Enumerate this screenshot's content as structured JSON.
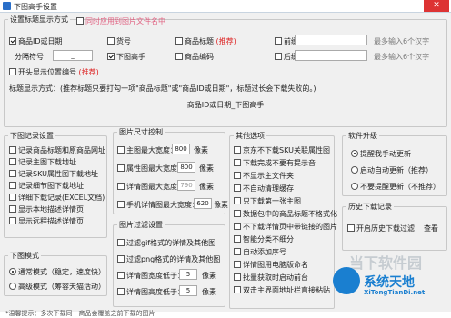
{
  "window": {
    "title": "下图高手设置",
    "close": "✕"
  },
  "title_fmt": {
    "legend": "设置标题显示方式",
    "sync_label": "同时应用到图片文件名中",
    "options": [
      {
        "label": "商品ID或日期",
        "checked": true
      },
      {
        "label": "货号",
        "checked": false
      },
      {
        "label": "商品标题",
        "checked": false,
        "note": "(推荐)"
      },
      {
        "label": "前缀",
        "checked": false
      },
      {
        "label": "下图高手",
        "checked": true
      },
      {
        "label": "商品编码",
        "checked": false
      },
      {
        "label": "后缀",
        "checked": false
      }
    ],
    "max_hint_1": "最多输入6个汉字",
    "max_hint_2": "最多输入6个汉字",
    "separator_label": "分隔符号",
    "separator_value": "_",
    "keep_sort": "开头显示位置编号",
    "keep_sort_note": "(推荐)",
    "format_desc": "标题显示方式：(推荐标题只要打勾一项\"商品标题\"或\"商品ID或日期\"，标题过长会下载失败的。)",
    "preview": "商品ID或日期_下图高手"
  },
  "record": {
    "legend": "下图记录设置",
    "items": [
      {
        "label": "记录商品标题和原商品网址",
        "checked": false
      },
      {
        "label": "记录主图下载地址",
        "checked": false
      },
      {
        "label": "记录SKU属性图下载地址",
        "checked": false
      },
      {
        "label": "记录细节图下载地址",
        "checked": false
      },
      {
        "label": "详细下载记录(EXCEL文档)",
        "checked": false
      },
      {
        "label": "显示本地描述详情页",
        "checked": false
      },
      {
        "label": "显示远程描述详情页",
        "checked": false
      }
    ]
  },
  "mode": {
    "legend": "下图模式",
    "items": [
      {
        "label": "通常模式（稳定，速度快）",
        "checked": true
      },
      {
        "label": "高级模式（筹容天猫活动）",
        "checked": false
      }
    ]
  },
  "size": {
    "legend": "图片尺寸控制",
    "rows": [
      {
        "label": "主图最大宽度：",
        "value": "800",
        "unit": "像素",
        "checked": false
      },
      {
        "label": "属性图最大宽度：",
        "value": "800",
        "unit": "像素",
        "checked": false
      },
      {
        "label": "详情图最大宽度：",
        "value": "790",
        "unit": "像素",
        "checked": false
      },
      {
        "label": "手机详情图最大宽度：",
        "value": "620",
        "unit": "像素",
        "checked": false
      }
    ]
  },
  "filter": {
    "legend": "图片过滤设置",
    "rows": [
      {
        "label": "过滤gif格式的详情及其他图",
        "checked": false
      },
      {
        "label": "过滤png格式的详情及其他图",
        "checked": false
      },
      {
        "label": "详情图宽度低于：",
        "value": "5",
        "unit": "像素",
        "checked": false
      },
      {
        "label": "详情图高度低于：",
        "value": "5",
        "unit": "像素",
        "checked": false
      }
    ]
  },
  "other": {
    "legend": "其他选项",
    "items": [
      {
        "label": "京东不下载SKU关联属性图",
        "checked": false
      },
      {
        "label": "下载完成不要有提示音",
        "checked": false
      },
      {
        "label": "不显示主文件夹",
        "checked": false
      },
      {
        "label": "不自动清理缓存",
        "checked": false
      },
      {
        "label": "只下载第一张主图",
        "checked": false
      },
      {
        "label": "数据包中的商品标题不格式化",
        "checked": false
      },
      {
        "label": "不下载详情页中带链接的图片",
        "checked": false
      },
      {
        "label": "智能分类不细分",
        "checked": false
      },
      {
        "label": "自动添加序号",
        "checked": false
      },
      {
        "label": "详情图用电脑版命名",
        "checked": false
      },
      {
        "label": "批量获取时启动前台",
        "checked": false
      },
      {
        "label": "双击主界面地址栏直接粘贴",
        "checked": false
      }
    ]
  },
  "update": {
    "legend": "软件升级",
    "items": [
      {
        "label": "提醒我手动更新",
        "checked": true
      },
      {
        "label": "启动自动更新（推荐）",
        "checked": false
      },
      {
        "label": "不要提醒更新（不推荐）",
        "checked": false
      }
    ]
  },
  "history": {
    "legend": "历史下载记录",
    "checkbox_label": "开启历史下载过滤",
    "checked": false,
    "view_button": "查看"
  },
  "bottom_text": "*温馨提示：多次下载同一商品会覆盖之前下载的图片",
  "watermark": {
    "brand1": "当下软件园",
    "brand2": "系统天地",
    "url": "XiTongTianDi.net"
  }
}
